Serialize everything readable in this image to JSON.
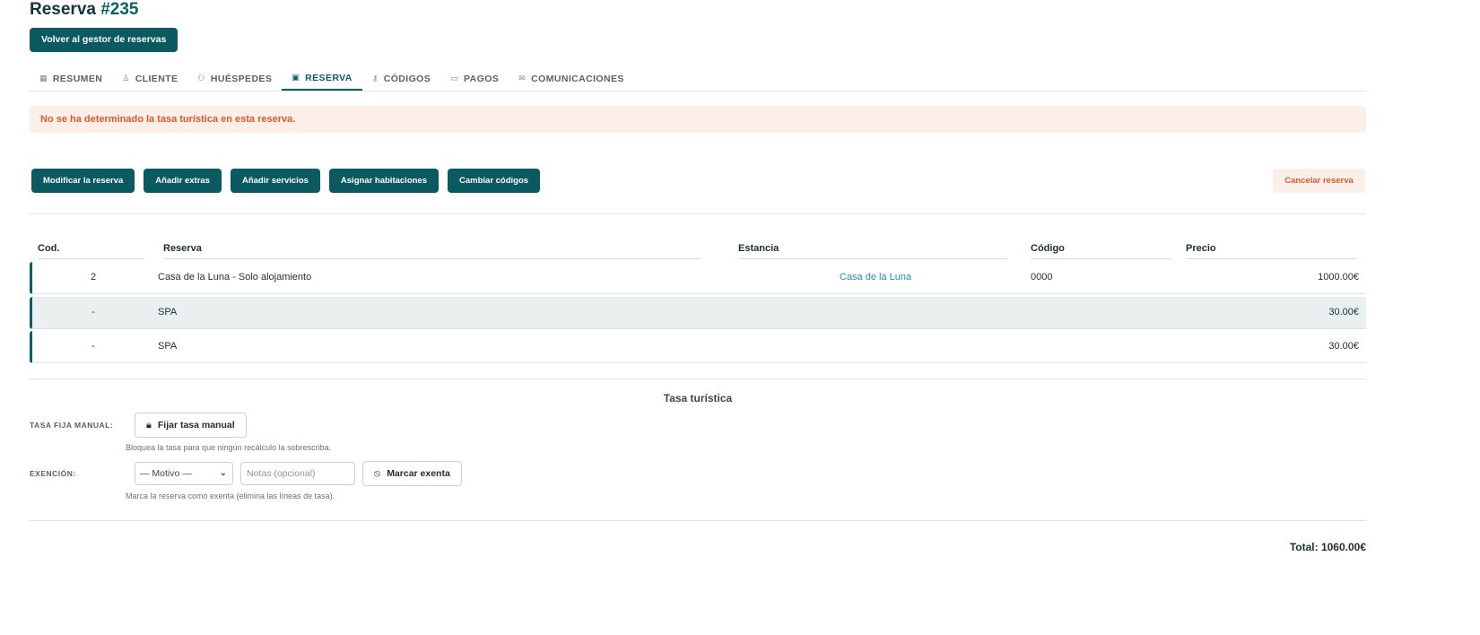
{
  "header": {
    "title_prefix": "Reserva",
    "title_number": "#235",
    "back_label": "Volver al gestor de reservas"
  },
  "tabs": [
    {
      "label": "RESUMEN",
      "icon": "grid-icon"
    },
    {
      "label": "CLIENTE",
      "icon": "user-icon"
    },
    {
      "label": "HUÉSPEDES",
      "icon": "users-icon"
    },
    {
      "label": "RESERVA",
      "icon": "calendar-icon",
      "active": true
    },
    {
      "label": "CÓDIGOS",
      "icon": "key-icon"
    },
    {
      "label": "PAGOS",
      "icon": "card-icon"
    },
    {
      "label": "COMUNICACIONES",
      "icon": "mail-icon"
    }
  ],
  "alert": {
    "text": "No se ha determinado la tasa turística en esta reserva."
  },
  "actions": {
    "modify": "Modificar la reserva",
    "extras": "Añadir extras",
    "services": "Añadir servicios",
    "rooms": "Asignar habitaciones",
    "codes": "Cambiar códigos",
    "cancel": "Cancelar reserva"
  },
  "table": {
    "headers": {
      "cod": "Cod.",
      "reserva": "Reserva",
      "estancia": "Estancia",
      "codigo": "Código",
      "precio": "Precio"
    },
    "rows": [
      {
        "cod": "2",
        "reserva": "Casa de la Luna - Solo alojamiento",
        "estancia": "Casa de la Luna",
        "codigo": "0000",
        "precio": "1000.00€"
      },
      {
        "cod": "-",
        "reserva": "SPA",
        "estancia": "",
        "codigo": "",
        "precio": "30.00€"
      },
      {
        "cod": "-",
        "reserva": "SPA",
        "estancia": "",
        "codigo": "",
        "precio": "30.00€"
      }
    ]
  },
  "tasa": {
    "title": "Tasa turística",
    "manual_label": "TASA FIJA MANUAL:",
    "manual_button": "Fijar tasa manual",
    "manual_help": "Bloquea la tasa para que ningún recálculo la sobrescriba.",
    "exempt_label": "EXENCIÓN:",
    "motivo_value": "— Motivo —",
    "notes_placeholder": "Notas (opcional)",
    "exempt_button": "Marcar exenta",
    "exempt_help": "Marca la reserva como exenta (elimina las líneas de tasa)."
  },
  "total": {
    "text": "Total: 1060.00€"
  },
  "colors": {
    "primary": "#0b5a61",
    "accent_text": "#0b5f67",
    "danger": "#dd5a2b",
    "danger_bg": "#fcefe9",
    "link": "#1f8fbf"
  }
}
